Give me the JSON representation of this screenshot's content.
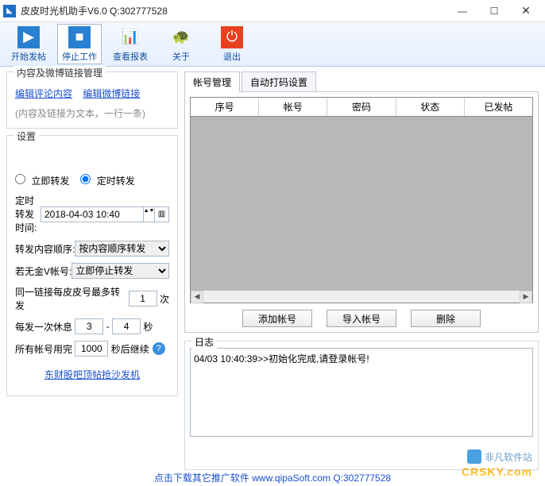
{
  "window": {
    "title": "皮皮时光机助手V6.0  Q:302777528"
  },
  "toolbar": {
    "start": "开始发帖",
    "stop": "停止工作",
    "report": "查看报表",
    "about": "关于",
    "exit": "退出"
  },
  "leftpanel": {
    "group1_title": "内容及微博链接管理",
    "edit_comment": "编辑评论内容",
    "edit_weibo_link": "编辑微博链接",
    "hint": "(内容及链接为文本，一行一条)",
    "settings_title": "设置",
    "radio_immediate": "立即转发",
    "radio_scheduled": "定时转发",
    "scheduled_label": "定时转发时间:",
    "scheduled_value": "2018-04-03 10:40",
    "content_order_label": "转发内容顺序:",
    "content_order_value": "按内容顺序转发",
    "no_gold_label": "若无金V帐号:",
    "no_gold_value": "立即停止转发",
    "same_link_prefix": "同一链接每皮皮号最多转发",
    "same_link_value": "1",
    "same_link_suffix": "次",
    "rest_prefix": "每发一次休息",
    "rest_min": "3",
    "rest_dash": "-",
    "rest_max": "4",
    "rest_suffix": "秒",
    "all_used_prefix": "所有帐号用完",
    "all_used_value": "1000",
    "all_used_suffix": "秒后继续",
    "promo_link": "东财股吧顶帖抢沙发机"
  },
  "tabs": {
    "tab_account": "帐号管理",
    "tab_dama": "自动打码设置"
  },
  "table": {
    "cols": [
      "序号",
      "帐号",
      "密码",
      "状态",
      "已发帖"
    ]
  },
  "buttons": {
    "add": "添加帐号",
    "import": "导入帐号",
    "delete": "删除"
  },
  "log": {
    "title": "日志",
    "line1": "04/03 10:40:39>>初始化完成,请登录帐号!"
  },
  "watermark": {
    "site_zh": "非凡软件站",
    "site_en": "CRSKY.com"
  },
  "footer": {
    "text_prefix": "点击下载其它推广软件  ",
    "url": "www.qipaSoft.com",
    "qq": " Q:302777528"
  }
}
